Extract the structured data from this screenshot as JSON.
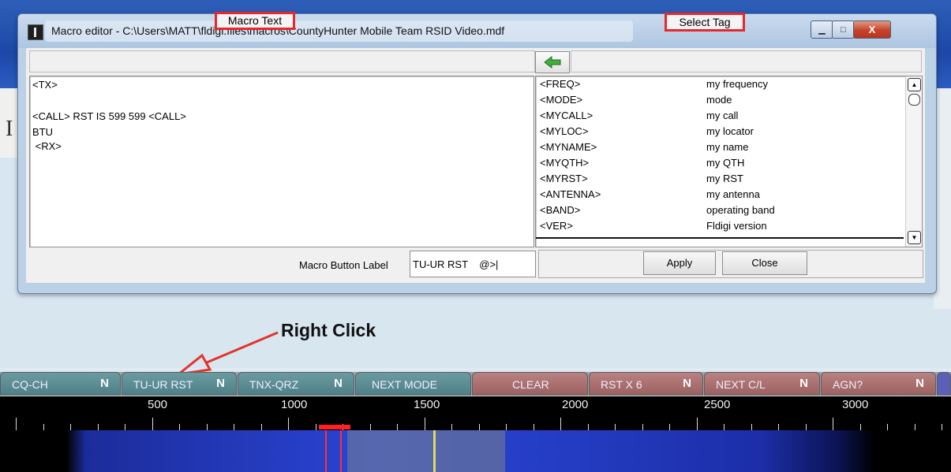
{
  "window": {
    "title": "Macro editor - C:\\Users\\MATT\\fldigi.files\\macros\\CountyHunter Mobile Team RSID Video.mdf",
    "controls": {
      "minimize": "▁",
      "maximize": "□",
      "close": "X"
    }
  },
  "macro_text": {
    "header": "Macro Text",
    "lines": [
      "<TX>",
      "",
      "<CALL> RST IS 599 599 <CALL>",
      "BTU",
      " <RX>"
    ]
  },
  "select_tag": {
    "header": "Select Tag",
    "insert_arrow_icon": "green-left-arrow-icon",
    "tags": [
      {
        "tag": "<FREQ>",
        "desc": "my frequency"
      },
      {
        "tag": "<MODE>",
        "desc": "mode"
      },
      {
        "tag": "<MYCALL>",
        "desc": "my call"
      },
      {
        "tag": "<MYLOC>",
        "desc": "my locator"
      },
      {
        "tag": "<MYNAME>",
        "desc": "my name"
      },
      {
        "tag": "<MYQTH>",
        "desc": "my QTH"
      },
      {
        "tag": "<MYRST>",
        "desc": "my RST"
      },
      {
        "tag": "<ANTENNA>",
        "desc": "my antenna"
      },
      {
        "tag": "<BAND>",
        "desc": "operating band"
      },
      {
        "tag": "<VER>",
        "desc": "Fldigi version"
      }
    ]
  },
  "bottom": {
    "label_caption": "Macro Button Label",
    "label_value": "TU-UR RST    @>|",
    "apply": "Apply",
    "close": "Close"
  },
  "annotation": {
    "text": "Right Click",
    "color": "#e3342b"
  },
  "macro_buttons": [
    {
      "label": "CQ-CH",
      "indicator": "Ν",
      "style": "teal"
    },
    {
      "label": "TU-UR RST",
      "indicator": "Ν",
      "style": "teal"
    },
    {
      "label": "TNX-QRZ",
      "indicator": "Ν",
      "style": "teal"
    },
    {
      "label": "NEXT MODE",
      "indicator": "",
      "style": "teal"
    },
    {
      "label": "CLEAR",
      "indicator": "",
      "style": "rose"
    },
    {
      "label": "RST X 6",
      "indicator": "Ν",
      "style": "rose"
    },
    {
      "label": "NEXT C/L",
      "indicator": "Ν",
      "style": "rose"
    },
    {
      "label": "AGN?",
      "indicator": "Ν",
      "style": "rose"
    }
  ],
  "freq_scale": {
    "labels": [
      "500",
      "1000",
      "1500",
      "2000",
      "2500",
      "3000"
    ]
  },
  "colors": {
    "accent_red": "#e8262c",
    "teal_button": "#5a8b91",
    "rose_button": "#a86b6b"
  }
}
